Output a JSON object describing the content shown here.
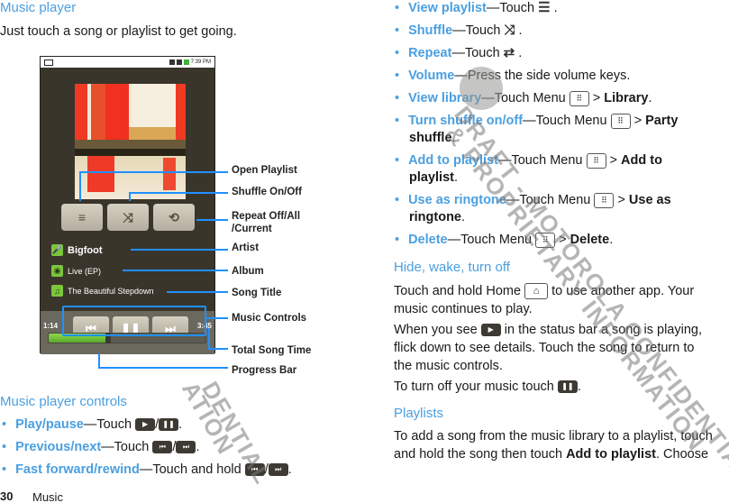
{
  "left": {
    "heading": "Music player",
    "intro": "Just touch a song or playlist to get going.",
    "phone": {
      "status_time": "7:39 PM",
      "artist": "Bigfoot",
      "album": "Live (EP)",
      "song": "The Beautiful Stepdown",
      "elapsed": "1:14",
      "total": "3:45",
      "progress_fraction": 0.38,
      "buttons": {
        "playlist_icon": "≡",
        "shuffle_icon": "⤨",
        "repeat_icon": "⟲",
        "prev_icon": "⏮",
        "pause_icon": "❚❚",
        "next_icon": "⏭"
      }
    },
    "callouts": {
      "open_playlist": "Open Playlist",
      "shuffle": "Shuffle On/Off",
      "repeat_line1": "Repeat Off/All",
      "repeat_line2": "/Current",
      "artist": "Artist",
      "album": "Album",
      "song_title": "Song Title",
      "music_controls": "Music Controls",
      "total_song_time": "Total Song Time",
      "progress_bar": "Progress Bar"
    },
    "controls_heading": "Music player controls",
    "controls": [
      {
        "label": "Play/pause",
        "text": "—Touch",
        "icons": [
          "▶",
          "❚❚"
        ],
        "suffix": "."
      },
      {
        "label": "Previous/next",
        "text": "—Touch",
        "icons": [
          "⏮",
          "⏭"
        ],
        "suffix": "."
      },
      {
        "label": "Fast forward/rewind",
        "text": "—Touch and hold",
        "icons": [
          "⏮",
          "⏭"
        ],
        "suffix": "."
      }
    ],
    "footer_page": "30",
    "footer_section": "Music"
  },
  "right": {
    "bullets": {
      "view_playlist": {
        "label": "View playlist",
        "text": "—Touch",
        "suffix": " ."
      },
      "shuffle": {
        "label": "Shuffle",
        "text": "—Touch",
        "suffix": " ."
      },
      "repeat": {
        "label": "Repeat",
        "text": "—Touch",
        "suffix": " ."
      },
      "volume": {
        "label": "Volume",
        "text": "—Press the side volume keys."
      },
      "view_library": {
        "label": "View library",
        "text": "—Touch Menu",
        "sep": " > ",
        "target": "Library",
        "suffix": "."
      },
      "turn_shuffle": {
        "label": "Turn shuffle on/off",
        "text": "—Touch Menu",
        "sep": " > ",
        "target1": "Party",
        "target2": "shuffle",
        "suffix": "."
      },
      "add_playlist": {
        "label": "Add to playlist",
        "text": "—Touch Menu",
        "sep": " > ",
        "target1": "Add to",
        "target2": "playlist",
        "suffix": "."
      },
      "ringtone": {
        "label": "Use as ringtone",
        "text": "—Touch Menu",
        "sep": " > ",
        "target1": "Use as",
        "target2": "ringtone",
        "suffix": "."
      },
      "delete": {
        "label": "Delete",
        "text": "—Touch Menu",
        "sep": " > ",
        "target": "Delete",
        "suffix": "."
      }
    },
    "hide_heading": "Hide, wake, turn off",
    "hide_p1_a": "Touch and hold Home",
    "hide_p1_b": " to use another app. Your",
    "hide_p1_c": "music continues to play.",
    "hide_p2_a": "When you see",
    "hide_p2_b": " in the status bar a song is playing,",
    "hide_p2_c": "flick down to see details. Touch the song to return to",
    "hide_p2_d": "the music controls.",
    "hide_p3": "To turn off your music touch",
    "hide_p3_end": ".",
    "playlists_heading": "Playlists",
    "playlists_p_a": "To add a song from the music library to a playlist, touch",
    "playlists_p_b": "and hold the song then touch ",
    "playlists_p_bold": "Add to playlist",
    "playlists_p_c": ". Choose"
  },
  "icons": {
    "menu_key": "⠿",
    "home_key": "⌂",
    "play_small": "▶",
    "pause_small": "❚❚",
    "playlist_inline": "☰",
    "shuffle_inline": "⤨",
    "repeat_inline": "⇄"
  },
  "watermark": {
    "line1": "DRAFT - MOTOROLA CONFIDENTIAL",
    "line2": "& PROPRIETARY INFORMATION",
    "fragment1": "DENTIAL",
    "fragment2": "ATION"
  }
}
